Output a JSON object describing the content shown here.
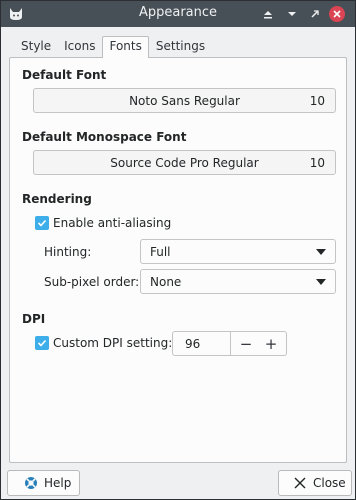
{
  "window": {
    "title": "Appearance"
  },
  "tabs": [
    {
      "label": "Style",
      "active": false
    },
    {
      "label": "Icons",
      "active": false
    },
    {
      "label": "Fonts",
      "active": true
    },
    {
      "label": "Settings",
      "active": false
    }
  ],
  "default_font": {
    "heading": "Default Font",
    "name": "Noto Sans Regular",
    "size": "10"
  },
  "monospace_font": {
    "heading": "Default Monospace Font",
    "name": "Source Code Pro Regular",
    "size": "10"
  },
  "rendering": {
    "heading": "Rendering",
    "antialias_label": "Enable anti-aliasing",
    "antialias_checked": true,
    "hinting_label": "Hinting:",
    "hinting_value": "Full",
    "subpixel_label": "Sub-pixel order:",
    "subpixel_value": "None"
  },
  "dpi": {
    "heading": "DPI",
    "custom_label": "Custom DPI setting:",
    "custom_checked": true,
    "value": "96",
    "decrement": "−",
    "increment": "+"
  },
  "footer": {
    "help_label": "Help",
    "close_label": "Close"
  },
  "colors": {
    "accent": "#3daee9",
    "titlebar": "#475057",
    "close_button": "#da4453"
  },
  "icons": {
    "app": "cat-icon",
    "help": "lifebuoy-icon",
    "close": "close-icon"
  }
}
